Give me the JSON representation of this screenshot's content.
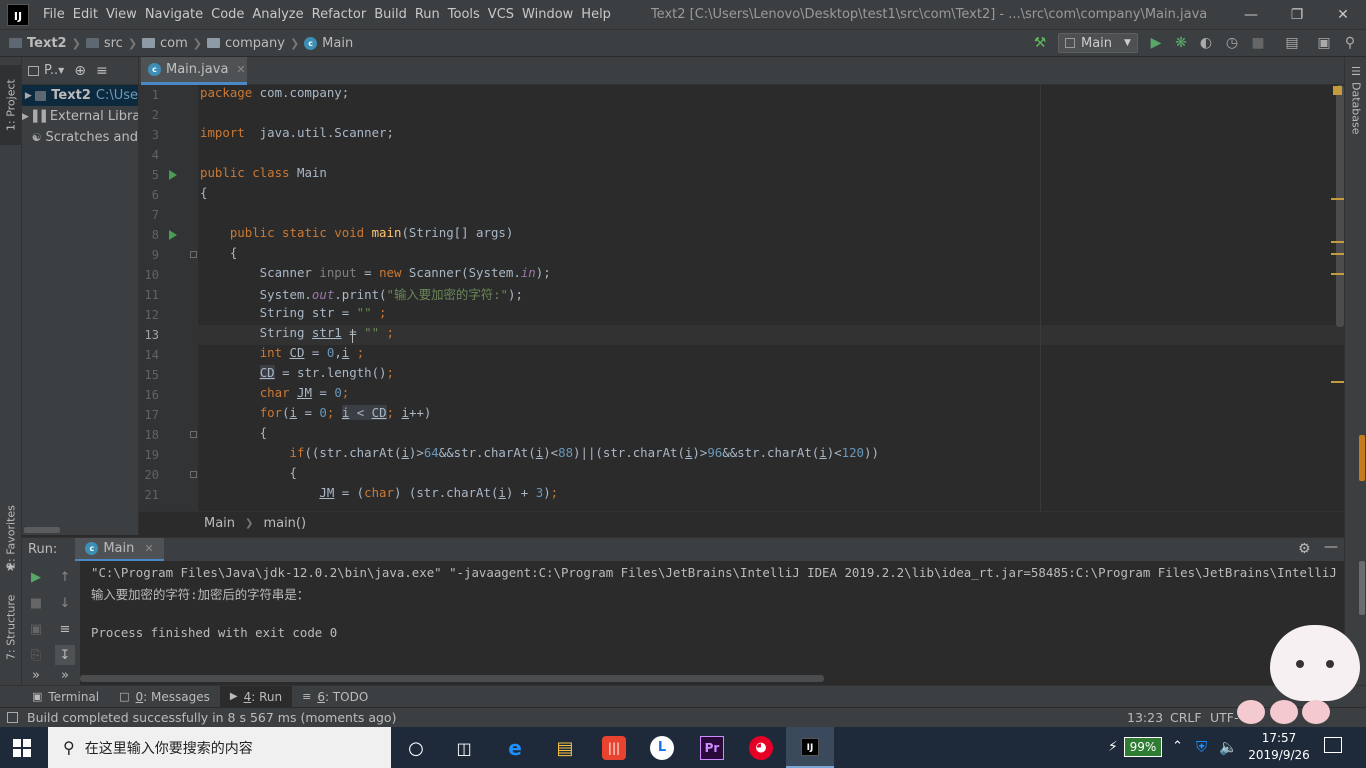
{
  "window": {
    "title": "Text2 [C:\\Users\\Lenovo\\Desktop\\test1\\src\\com\\Text2] - ...\\src\\com\\company\\Main.java",
    "menu": [
      "File",
      "Edit",
      "View",
      "Navigate",
      "Code",
      "Analyze",
      "Refactor",
      "Build",
      "Run",
      "Tools",
      "VCS",
      "Window",
      "Help"
    ]
  },
  "breadcrumb": [
    "Text2",
    "src",
    "com",
    "company",
    "Main"
  ],
  "toolbar": {
    "run_config": "Main"
  },
  "left_tabs": {
    "project": "1: Project",
    "favorites": "2: Favorites",
    "structure": "7: Structure"
  },
  "right_tabs": {
    "database": "Database"
  },
  "project_panel": {
    "title": "P..",
    "items": [
      {
        "name": "Text2",
        "path": "C:\\Use"
      },
      {
        "name": "External Libra"
      },
      {
        "name": "Scratches and"
      }
    ]
  },
  "editor": {
    "tab": "Main.java",
    "line_numbers": [
      "1",
      "2",
      "3",
      "4",
      "5",
      "6",
      "7",
      "8",
      "9",
      "10",
      "11",
      "12",
      "13",
      "14",
      "15",
      "16",
      "17",
      "18",
      "19",
      "20",
      "21"
    ],
    "breadcrumb": [
      "Main",
      "main()"
    ]
  },
  "run_panel": {
    "label": "Run:",
    "tab": "Main",
    "lines": [
      "\"C:\\Program Files\\Java\\jdk-12.0.2\\bin\\java.exe\" \"-javaagent:C:\\Program Files\\JetBrains\\IntelliJ IDEA 2019.2.2\\lib\\idea_rt.jar=58485:C:\\Program Files\\JetBrains\\IntelliJ IDEA 2019.2",
      "输入要加密的字符:加密后的字符串是：",
      "",
      "Process finished with exit code 0"
    ]
  },
  "bottom_tabs": [
    {
      "key": "",
      "label": "Terminal"
    },
    {
      "key": "0",
      "label": ": Messages"
    },
    {
      "key": "4",
      "label": ": Run"
    },
    {
      "key": "6",
      "label": ": TODO"
    }
  ],
  "status": {
    "message": "Build completed successfully in 8 s 567 ms (moments ago)",
    "position": "13:23",
    "line_sep": "CRLF",
    "encoding": "UTF-"
  },
  "taskbar": {
    "search_placeholder": "在这里输入你要搜索的内容",
    "battery": "99%",
    "time": "17:57",
    "date": "2019/9/26"
  },
  "colors": {
    "keyword": "#cc7832",
    "string": "#6a8759",
    "number": "#6897bb",
    "method": "#ffc66d",
    "field": "#9876aa",
    "accent": "#4a88c7"
  }
}
